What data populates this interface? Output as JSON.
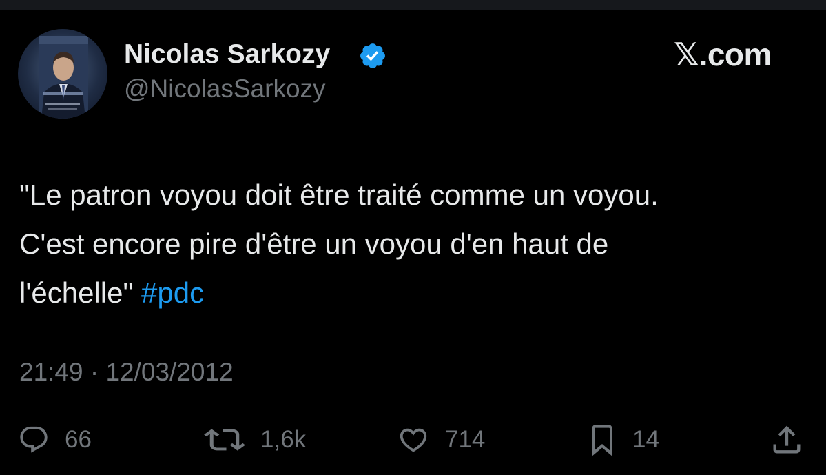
{
  "author": {
    "display_name": "Nicolas Sarkozy",
    "handle": "@NicolasSarkozy",
    "verified": true,
    "avatar_icon": "profile-photo-icon"
  },
  "brand": {
    "mark": "𝕏",
    "suffix": ".com"
  },
  "tweet": {
    "lines": [
      "\"Le patron voyou doit être traité comme un voyou.",
      "C'est encore pire d'être un voyou d'en haut de",
      "l'échelle\" "
    ],
    "hashtag": "#pdc",
    "timestamp": "21:49 · 12/03/2012"
  },
  "actions": {
    "reply": {
      "icon": "reply-icon",
      "count": "66"
    },
    "retweet": {
      "icon": "retweet-icon",
      "count": "1,6k"
    },
    "like": {
      "icon": "heart-icon",
      "count": "714"
    },
    "bookmark": {
      "icon": "bookmark-icon",
      "count": "14"
    },
    "share": {
      "icon": "share-icon"
    }
  },
  "colors": {
    "background": "#000000",
    "text": "#e7e9ea",
    "secondary_text": "#71767b",
    "accent": "#1d9bf0"
  }
}
